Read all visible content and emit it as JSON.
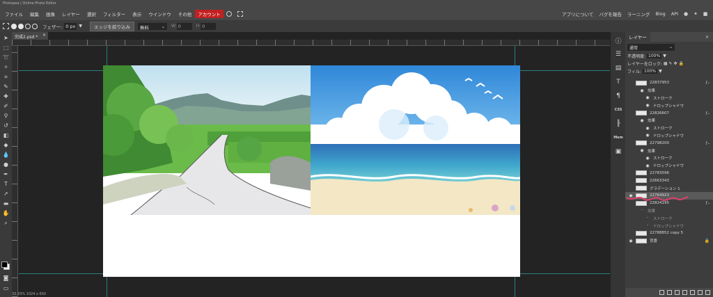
{
  "app_title": "Photopea | Online Photo Editor",
  "menu": {
    "items": [
      "ファイル",
      "編集",
      "画像",
      "レイヤー",
      "選択",
      "フィルター",
      "表示",
      "ウインドウ",
      "その他"
    ],
    "account": "アカウント",
    "right": [
      "アプリについて",
      "バグを報告",
      "ラーニング",
      "Blog",
      "API"
    ]
  },
  "options": {
    "feather_label": "フェザー:",
    "feather_value": "0 px",
    "refine_edge": "エッジを絞り込み",
    "style_value": "無料",
    "width_label": "W:",
    "width_value": "0",
    "height_label": "H:",
    "height_value": "0"
  },
  "document_tab": {
    "name": "完成2.psd *"
  },
  "status": "33.33%   1024 x 650",
  "layers_panel": {
    "tab": "レイヤー",
    "blend_mode": "通常",
    "opacity_label": "不透明度:",
    "opacity_value": "100%",
    "lock_label": "レイヤーをロック:",
    "fill_label": "フィル:",
    "fill_value": "100%",
    "layers": [
      {
        "name": "22837953",
        "visible": false,
        "fx": true,
        "indent": 0
      },
      {
        "name": "効果",
        "visible": true,
        "indent": 1
      },
      {
        "name": "ストローク",
        "visible": true,
        "indent": 2
      },
      {
        "name": "ドロップシャドウ",
        "visible": true,
        "indent": 2
      },
      {
        "name": "22826607",
        "visible": false,
        "fx": true,
        "indent": 0
      },
      {
        "name": "効果",
        "visible": true,
        "indent": 1
      },
      {
        "name": "ストローク",
        "visible": true,
        "indent": 2
      },
      {
        "name": "ドロップシャドウ",
        "visible": true,
        "indent": 2
      },
      {
        "name": "22798200",
        "visible": false,
        "fx": true,
        "indent": 0
      },
      {
        "name": "効果",
        "visible": true,
        "indent": 1
      },
      {
        "name": "ストローク",
        "visible": true,
        "indent": 2
      },
      {
        "name": "ドロップシャドウ",
        "visible": true,
        "indent": 2
      },
      {
        "name": "22783596",
        "visible": false,
        "indent": 0
      },
      {
        "name": "22663343",
        "visible": false,
        "indent": 0
      },
      {
        "name": "グラデーション 1",
        "visible": false,
        "indent": 0
      },
      {
        "name": "22764923",
        "visible": true,
        "indent": 0,
        "selected": true
      },
      {
        "name": "22824195",
        "visible": false,
        "fx": true,
        "indent": 0
      },
      {
        "name": "効果",
        "visible": false,
        "indent": 1
      },
      {
        "name": "ストローク",
        "visible": false,
        "indent": 2
      },
      {
        "name": "ドロップシャドウ",
        "visible": false,
        "indent": 2
      },
      {
        "name": "22788852 copy 5",
        "visible": false,
        "indent": 0
      },
      {
        "name": "背景",
        "visible": true,
        "indent": 0,
        "locked": true
      }
    ]
  },
  "side_panel": {
    "css_label": "CSS",
    "mem_label": "Mem"
  },
  "colors": {
    "accent_account": "#c32020",
    "guide": "#2f8f8f",
    "annotation": "#e04070"
  }
}
